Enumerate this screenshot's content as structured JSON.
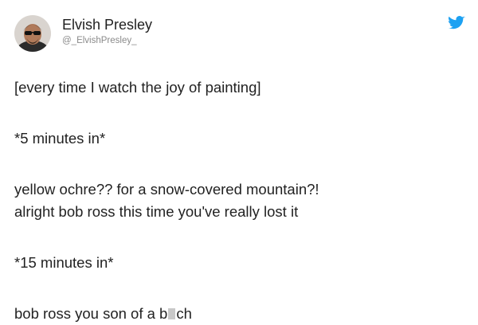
{
  "tweet": {
    "display_name": "Elvish Presley",
    "handle": "@_ElvishPresley_",
    "icons": {
      "avatar": "avatar-photo",
      "brand": "twitter-bird-icon"
    },
    "colors": {
      "twitter_blue": "#1da1f2",
      "text": "#222222",
      "handle": "#8a8a8a"
    },
    "lines": [
      "[every time I watch the joy of painting]",
      "*5 minutes in*",
      "yellow ochre?? for a snow-covered mountain?!",
      "alright bob ross this time you've really lost it",
      "*15 minutes in*"
    ],
    "last_line": {
      "before": "bob ross you son of a b",
      "after": "ch"
    }
  }
}
